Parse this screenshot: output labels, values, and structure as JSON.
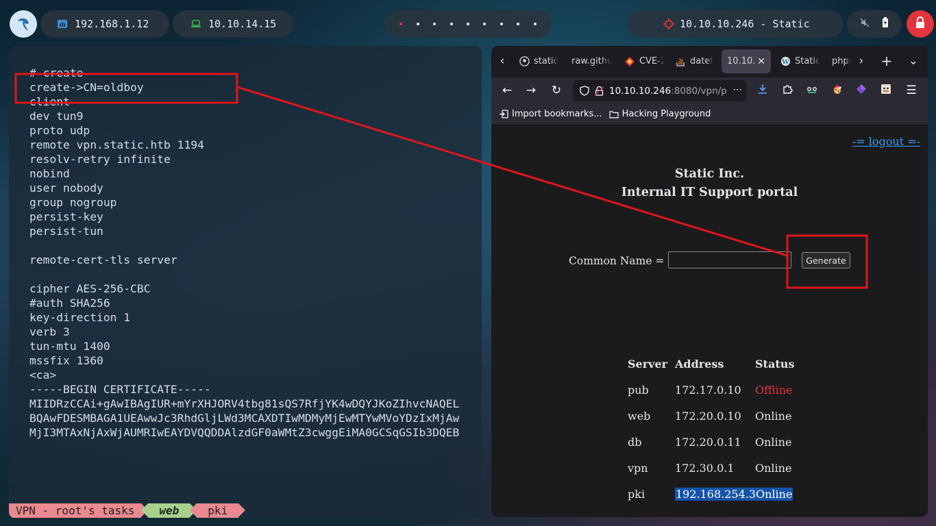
{
  "topbar": {
    "ip_local": "192.168.1.12",
    "ip_vpn": "10.10.14.15",
    "target": "10.10.10.246 - Static",
    "workspace_count": 9,
    "active_workspace": 1,
    "colors": {
      "pill": "#28343e",
      "lock": "#e2343a",
      "accent_vpn": "#3ab34a",
      "accent_local": "#3b8ed8",
      "target_icon": "#e0322f"
    }
  },
  "terminal": {
    "lines": [
      "# create",
      "create->CN=oldboy",
      "client",
      "dev tun9",
      "proto udp",
      "remote vpn.static.htb 1194",
      "resolv-retry infinite",
      "nobind",
      "user nobody",
      "group nogroup",
      "persist-key",
      "persist-tun",
      "",
      "remote-cert-tls server",
      "",
      "cipher AES-256-CBC",
      "#auth SHA256",
      "key-direction 1",
      "verb 3",
      "tun-mtu 1400",
      "mssfix 1360",
      "<ca>",
      "-----BEGIN CERTIFICATE-----",
      "MIIDRzCCAi+gAwIBAgIUR+mYrXHJORV4tbg81sQS7RfjYK4wDQYJKoZIhvcNAQEL",
      "BQAwFDESMBAGA1UEAwwJc3RhdGljLWd3MCAXDTIwMDMyMjEwMTYwMVoYDzIxMjAw",
      "MjI3MTAxNjAxWjAUMRIwEAYDVQQDDAlzdGF0aWMtZ3cwggEiMA0GCSqGSIb3DQEB"
    ],
    "tmux": {
      "session": "VPN - root's tasks",
      "active_window": "web",
      "window2": "pki"
    },
    "colors": {
      "session_bg": "#e88a8f",
      "active_bg": "#a6d08c"
    }
  },
  "browser": {
    "tabs": [
      {
        "label": "static",
        "icon": "github-icon"
      },
      {
        "label": "raw.githu",
        "icon": "none"
      },
      {
        "label": "CVE-2",
        "icon": "diamond-icon"
      },
      {
        "label": "datet",
        "icon": "stackoverflow-icon"
      },
      {
        "label": "10.10.",
        "icon": "none",
        "active": true
      },
      {
        "label": "Static",
        "icon": "wordpress-icon"
      },
      {
        "label": "phpi",
        "icon": "none"
      }
    ],
    "url_host": "10.10.10.246",
    "url_rest": ":8080/vpn/p",
    "bookmarks": [
      {
        "label": "Import bookmarks...",
        "icon": "import-icon"
      },
      {
        "label": "Hacking Playground",
        "icon": "folder-icon"
      }
    ]
  },
  "page": {
    "logout": "-= logout =-",
    "title_line1": "Static Inc.",
    "title_line2": "Internal IT Support portal",
    "cn_label": "Common Name =",
    "cn_value": "",
    "generate": "Generate",
    "table_headers": [
      "Server",
      "Address",
      "Status"
    ],
    "servers": [
      {
        "server": "pub",
        "address": "172.17.0.10",
        "status": "Offline"
      },
      {
        "server": "web",
        "address": "172.20.0.10",
        "status": "Online"
      },
      {
        "server": "db",
        "address": "172.20.0.11",
        "status": "Online"
      },
      {
        "server": "vpn",
        "address": "172.30.0.1",
        "status": "Online"
      },
      {
        "server": "pki",
        "address": "192.168.254.3",
        "status": "Online"
      }
    ],
    "colors": {
      "offline": "#e8333a",
      "link": "#3d9cf0",
      "selection": "#1553a8"
    }
  },
  "annotation": {
    "color": "#e0151b"
  }
}
